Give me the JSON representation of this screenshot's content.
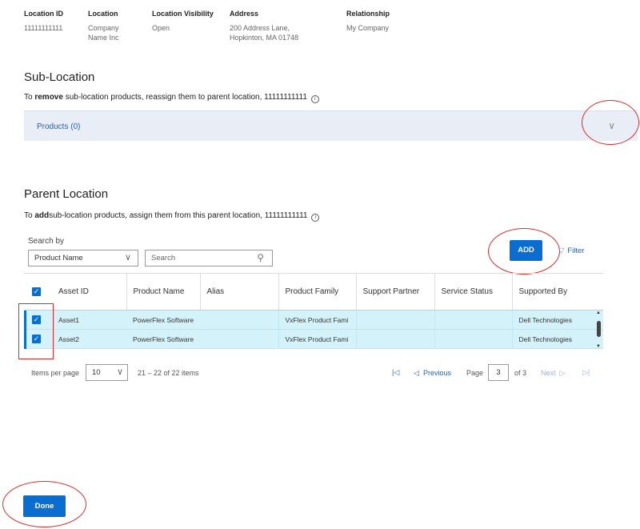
{
  "location_info": {
    "columns": [
      {
        "header": "Location ID",
        "value": "11111111111"
      },
      {
        "header": "Location",
        "value_line1": "Company",
        "value_line2": "Name Inc"
      },
      {
        "header": "Location Visibility",
        "value": "Open"
      },
      {
        "header": "Address",
        "value_line1": "200 Address Lane,",
        "value_line2": "Hopkinton, MA 01748"
      },
      {
        "header": "Relationship",
        "value": "My Company"
      }
    ]
  },
  "sub_location": {
    "title": "Sub-Location",
    "desc_prefix": "To ",
    "desc_bold": "remove",
    "desc_suffix": " sub-location products, reassign them to parent location, 11111111111",
    "products_label": "Products (0)"
  },
  "parent_location": {
    "title": "Parent Location",
    "desc_prefix": "To ",
    "desc_bold": "add",
    "desc_suffix": "sub-location products, assign them from this parent location, 11111111111",
    "search_by_label": "Search by",
    "search_by_selected": "Product Name",
    "search_placeholder": "Search",
    "add_label": "ADD",
    "filter_label": "Filter"
  },
  "table": {
    "headers": [
      "Asset ID",
      "Product Name",
      "Alias",
      "Product Family",
      "Support Partner",
      "Service Status",
      "Supported By"
    ],
    "rows": [
      {
        "checked": true,
        "asset_id": "Asset1",
        "product_name": "PowerFlex Software",
        "alias": "",
        "product_family": "VxFlex Product Fami",
        "support_partner": "",
        "service_status": "",
        "supported_by": "Dell Technologies"
      },
      {
        "checked": true,
        "asset_id": "Asset2",
        "product_name": "PowerFlex Software",
        "alias": "",
        "product_family": "VxFlex Product Fami",
        "support_partner": "",
        "service_status": "",
        "supported_by": "Dell Technologies"
      }
    ]
  },
  "pagination": {
    "items_per_page_label": "Items per page",
    "items_per_page_value": "10",
    "range_text": "21 – 22 of 22 items",
    "previous_label": "Previous",
    "page_label": "Page",
    "page_value": "3",
    "of_text": "of 3",
    "next_label": "Next"
  },
  "footer": {
    "done_label": "Done"
  },
  "icons": {
    "info": "info-circle-icon",
    "chevron": "chevron-down-icon",
    "search": "search-icon",
    "filter": "filter-icon",
    "first_page": "first-page-icon",
    "prev": "previous-icon",
    "next": "next-icon",
    "last_page": "last-page-icon"
  },
  "colors": {
    "accent": "#0a6ed1",
    "row_highlight": "#d4f2fa",
    "annotation": "#d92b2b",
    "link": "#2a5fae"
  }
}
